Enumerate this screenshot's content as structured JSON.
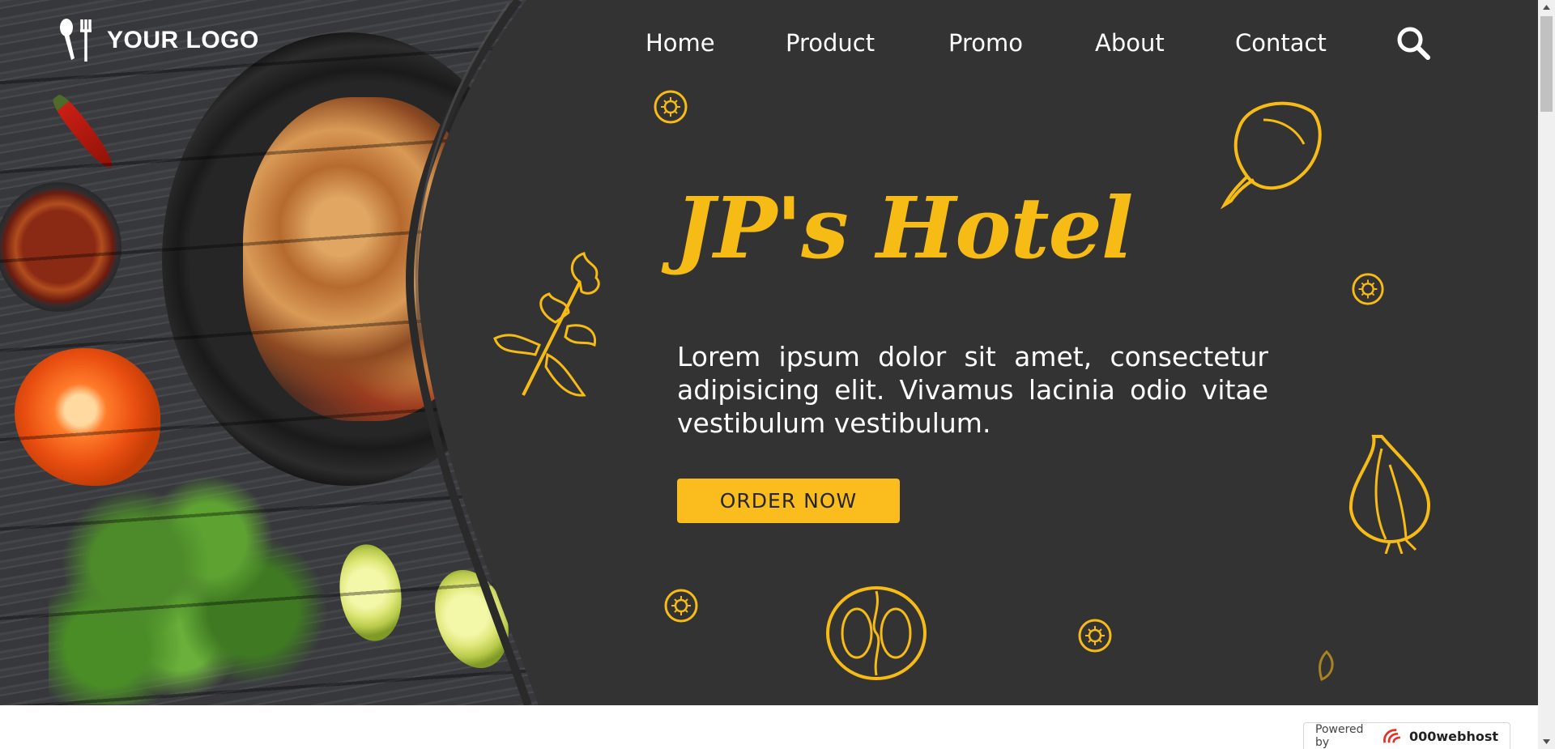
{
  "logo": {
    "text": "YOUR LOGO",
    "icon": "fork-spoon-icon"
  },
  "nav": {
    "items": [
      {
        "label": "Home"
      },
      {
        "label": "Product"
      },
      {
        "label": "Promo"
      },
      {
        "label": "About"
      },
      {
        "label": "Contact"
      }
    ],
    "search_icon": "search-icon"
  },
  "hero": {
    "title": "JP's Hotel",
    "lead": "Lorem ipsum dolor sit amet, consectetur adipisicing elit. Vivamus lacinia odio vitae vestibulum vestibulum.",
    "cta_label": "ORDER NOW"
  },
  "footer_badge": {
    "powered_by": "Powered by",
    "brand": "000webhost"
  },
  "colors": {
    "accent": "#fbbd1e",
    "background": "#333333",
    "text": "#ffffff"
  }
}
